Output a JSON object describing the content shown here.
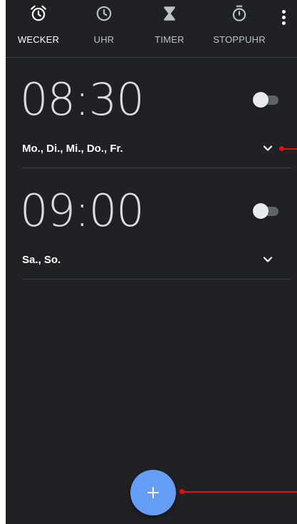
{
  "tabs": [
    {
      "label": "WECKER",
      "icon": "alarm-clock-icon",
      "active": true
    },
    {
      "label": "UHR",
      "icon": "clock-icon",
      "active": false
    },
    {
      "label": "TIMER",
      "icon": "hourglass-icon",
      "active": false
    },
    {
      "label": "STOPPUHR",
      "icon": "stopwatch-icon",
      "active": false
    }
  ],
  "alarms": [
    {
      "time": "08:30",
      "days": "Mo., Di., Mi., Do., Fr.",
      "enabled": false
    },
    {
      "time": "09:00",
      "days": "Sa., So.",
      "enabled": false
    }
  ],
  "fab": {
    "icon": "plus-icon",
    "symbol": "+"
  },
  "colors": {
    "background": "#202124",
    "fab": "#669df6",
    "annotation": "#e01010"
  }
}
